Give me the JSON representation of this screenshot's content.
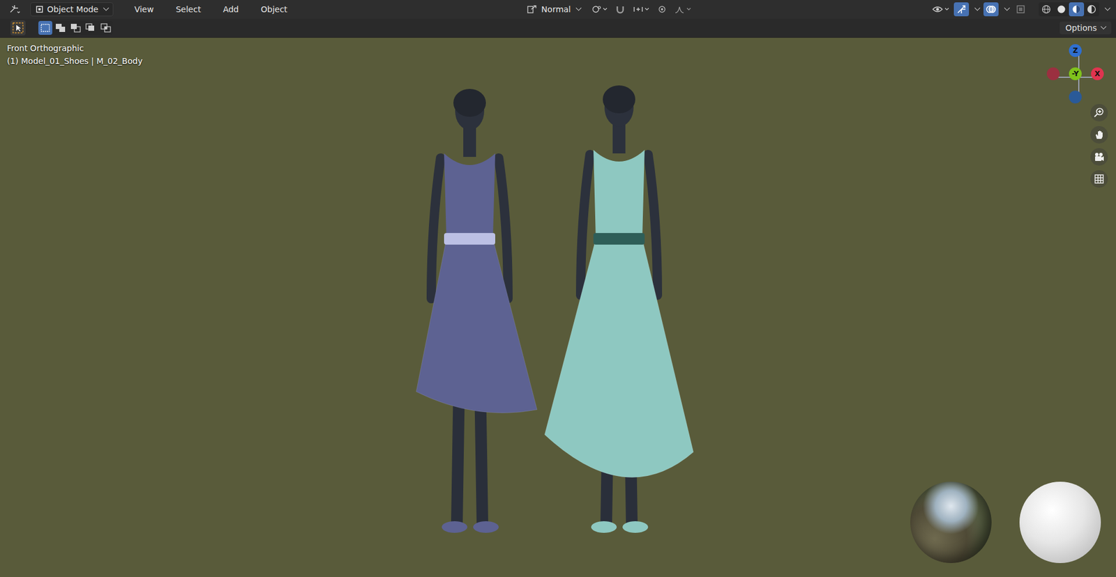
{
  "header": {
    "mode": "Object Mode",
    "menus": [
      "View",
      "Select",
      "Add",
      "Object"
    ],
    "orientation": "Normal",
    "snapping": {
      "on": false
    },
    "proportional": {
      "on": false
    },
    "gizmos": {
      "on": true
    },
    "overlays": {
      "on": true
    },
    "xray": {
      "on": false
    },
    "shading": [
      {
        "kind": "wireframe",
        "selected": false
      },
      {
        "kind": "solid",
        "selected": false
      },
      {
        "kind": "material",
        "selected": true
      },
      {
        "kind": "rendered",
        "selected": false
      }
    ]
  },
  "tool_settings": {
    "select_modes": [
      {
        "kind": "new",
        "selected": true
      },
      {
        "kind": "extend",
        "selected": false
      },
      {
        "kind": "subtract",
        "selected": false
      },
      {
        "kind": "invert",
        "selected": false
      },
      {
        "kind": "intersect",
        "selected": false
      }
    ],
    "options": "Options"
  },
  "viewport": {
    "view_name": "Front Orthographic",
    "object_info": "(1) Model_01_Shoes | M_02_Body",
    "gizmo_axes": [
      {
        "label": "Z",
        "color": "#2f6fd0"
      },
      {
        "label": "",
        "color": "#9b3040"
      },
      {
        "label": "-Y",
        "color": "#7fc31c"
      },
      {
        "label": "X",
        "color": "#e0344f"
      },
      {
        "label": "",
        "color": "#2a5a98"
      }
    ],
    "nav_buttons": [
      {
        "kind": "zoom"
      },
      {
        "kind": "pan"
      },
      {
        "kind": "camera"
      },
      {
        "kind": "grid"
      }
    ],
    "figures": [
      {
        "color": "#5d6292",
        "band_color": "#bcc0e4"
      },
      {
        "color": "#8ec8c1",
        "band_color": "#2e5e58"
      }
    ]
  }
}
